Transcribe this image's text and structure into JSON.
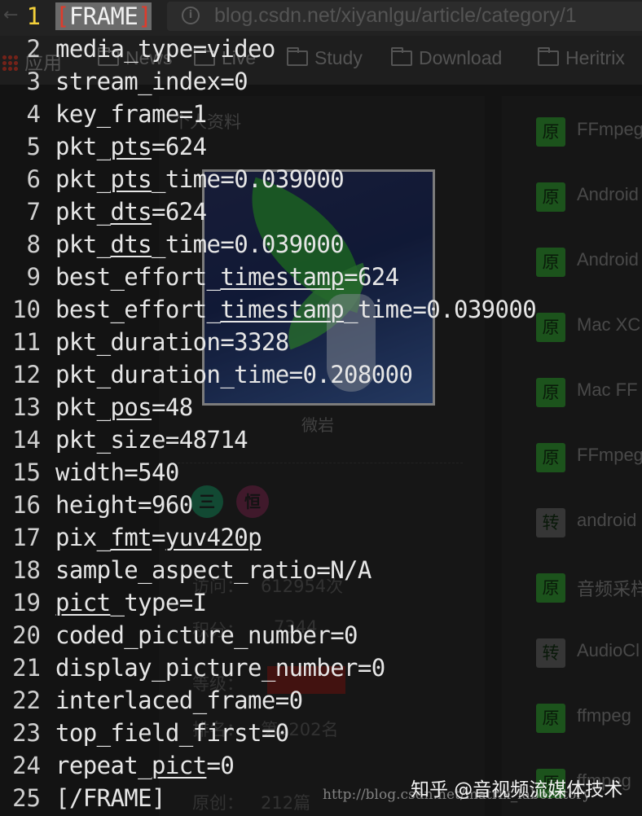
{
  "browser": {
    "url": "blog.csdn.net/xiyanlgu/article/category/1",
    "bookmarks": [
      "应用",
      "News",
      "Live",
      "Study",
      "Download",
      "Heritrix"
    ]
  },
  "profile": {
    "heading": "个人资料",
    "username": "微岩",
    "badges": [
      "三",
      "恒"
    ],
    "stats": [
      {
        "label": "访问：",
        "value": "612954次"
      },
      {
        "label": "积分：",
        "value": "7344"
      },
      {
        "label": "等级：",
        "value": ""
      },
      {
        "label": "排名：",
        "value": "第2202名"
      },
      {
        "label": "原创：",
        "value": "212篇"
      }
    ]
  },
  "articles": [
    {
      "tag": "原",
      "title": "FFmpeg"
    },
    {
      "tag": "原",
      "title": "Android"
    },
    {
      "tag": "原",
      "title": "Android"
    },
    {
      "tag": "原",
      "title": "Mac XC"
    },
    {
      "tag": "原",
      "title": "Mac FF"
    },
    {
      "tag": "原",
      "title": "FFmpeg"
    },
    {
      "tag": "转",
      "title": "android"
    },
    {
      "tag": "原",
      "title": "音频采样"
    },
    {
      "tag": "转",
      "title": "AudioCl"
    },
    {
      "tag": "原",
      "title": "ffmpeg"
    },
    {
      "tag": "原",
      "title": "ffmpeg"
    }
  ],
  "terminal": {
    "lines": [
      {
        "n": "1",
        "pre": "",
        "u": "",
        "post": ""
      },
      {
        "n": "2",
        "pre": "media_type=video",
        "u": "",
        "post": ""
      },
      {
        "n": "3",
        "pre": "stream_index=0",
        "u": "",
        "post": ""
      },
      {
        "n": "4",
        "pre": "key_frame=1",
        "u": "",
        "post": ""
      },
      {
        "n": "5",
        "pre": "pkt_",
        "u": "pts",
        "post": "=624"
      },
      {
        "n": "6",
        "pre": "pkt_",
        "u": "pts",
        "post": "_time=0.039000"
      },
      {
        "n": "7",
        "pre": "pkt_",
        "u": "dts",
        "post": "=624"
      },
      {
        "n": "8",
        "pre": "pkt_",
        "u": "dts",
        "post": "_time=0.039000"
      },
      {
        "n": "9",
        "pre": "best_effort_",
        "u": "timestamp",
        "post": "=624"
      },
      {
        "n": "10",
        "pre": "best_effort_",
        "u": "timestamp",
        "post": "_time=0.039000"
      },
      {
        "n": "11",
        "pre": "pkt_duration=3328",
        "u": "",
        "post": ""
      },
      {
        "n": "12",
        "pre": "pkt_duration_time=0.208000",
        "u": "",
        "post": ""
      },
      {
        "n": "13",
        "pre": "pkt_",
        "u": "pos",
        "post": "=48"
      },
      {
        "n": "14",
        "pre": "pkt_size=48714",
        "u": "",
        "post": ""
      },
      {
        "n": "15",
        "pre": "width=540",
        "u": "",
        "post": ""
      },
      {
        "n": "16",
        "pre": "height=960",
        "u": "",
        "post": ""
      },
      {
        "n": "17",
        "pre": "pix_",
        "u": "fmt",
        "post": "="
      },
      {
        "n": "18",
        "pre": "sample_aspect_ratio=N/A",
        "u": "",
        "post": ""
      },
      {
        "n": "19",
        "pre": "",
        "u": "pict",
        "post": "_type=I"
      },
      {
        "n": "20",
        "pre": "coded_picture_number=0",
        "u": "",
        "post": ""
      },
      {
        "n": "21",
        "pre": "display_picture_number=0",
        "u": "",
        "post": ""
      },
      {
        "n": "22",
        "pre": "interlaced_frame=0",
        "u": "",
        "post": ""
      },
      {
        "n": "23",
        "pre": "top_field_first=0",
        "u": "",
        "post": ""
      },
      {
        "n": "24",
        "pre": "repeat_",
        "u": "pict",
        "post": "=0"
      },
      {
        "n": "25",
        "pre": "[/FRAME]",
        "u": "",
        "post": ""
      }
    ],
    "frame_tag": {
      "open": "[",
      "word": "FRAME",
      "close": "]"
    },
    "pix_fmt_value": "yuv420p"
  },
  "watermark": "http://blog.csdn.net/matrix_laboratory",
  "zhihu_credit": "知乎 @音视频流媒体技术",
  "colors": {
    "current_line_number": "#f4d13a",
    "bracket": "#e03b2b",
    "tag_original": "#2f8a2f",
    "tag_repost": "#5a5a5a"
  }
}
